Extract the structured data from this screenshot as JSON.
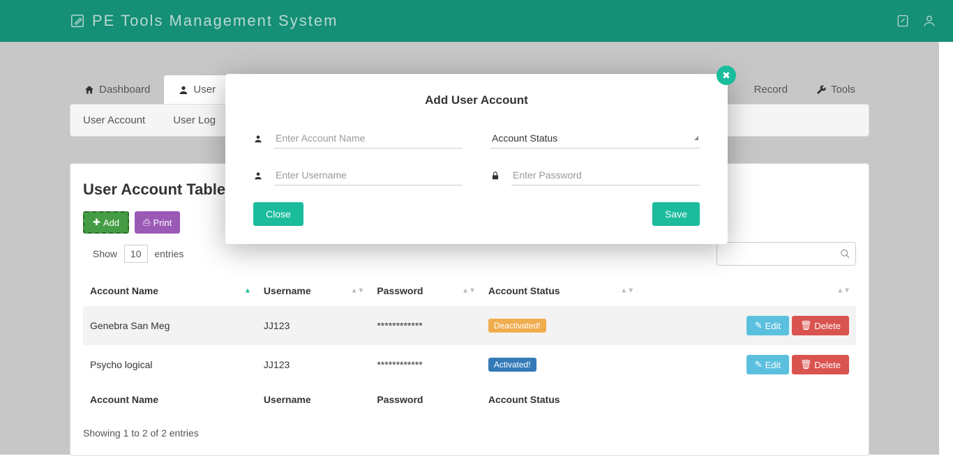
{
  "header": {
    "title": "PE Tools Management System"
  },
  "tabs": {
    "dashboard": "Dashboard",
    "user": "User",
    "record": "Record",
    "tools": "Tools"
  },
  "subnav": {
    "account": "User Account",
    "log": "User Log"
  },
  "card": {
    "title": "User Account Table"
  },
  "toolbar": {
    "add": "Add",
    "print": "Print"
  },
  "entries": {
    "show": "Show",
    "count": "10",
    "label": "entries"
  },
  "columns": {
    "account_name": "Account Name",
    "username": "Username",
    "password": "Password",
    "status": "Account Status"
  },
  "rows": [
    {
      "name": "Genebra San Meg",
      "username": "JJ123",
      "password": "************",
      "status": "Deactivated!",
      "status_class": "badge-deact"
    },
    {
      "name": "Psycho logical",
      "username": "JJ123",
      "password": "************",
      "status": "Activated!",
      "status_class": "badge-act"
    }
  ],
  "actions": {
    "edit": "Edit",
    "delete": "Delete"
  },
  "footer": {
    "account_name": "Account Name",
    "username": "Username",
    "password": "Password",
    "status": "Account Status"
  },
  "showing": "Showing 1 to 2 of 2 entries",
  "modal": {
    "title": "Add User Account",
    "account_name_ph": "Enter Account Name",
    "username_ph": "Enter Username",
    "password_ph": "Enter Password",
    "status_label": "Account Status",
    "close": "Close",
    "save": "Save"
  }
}
